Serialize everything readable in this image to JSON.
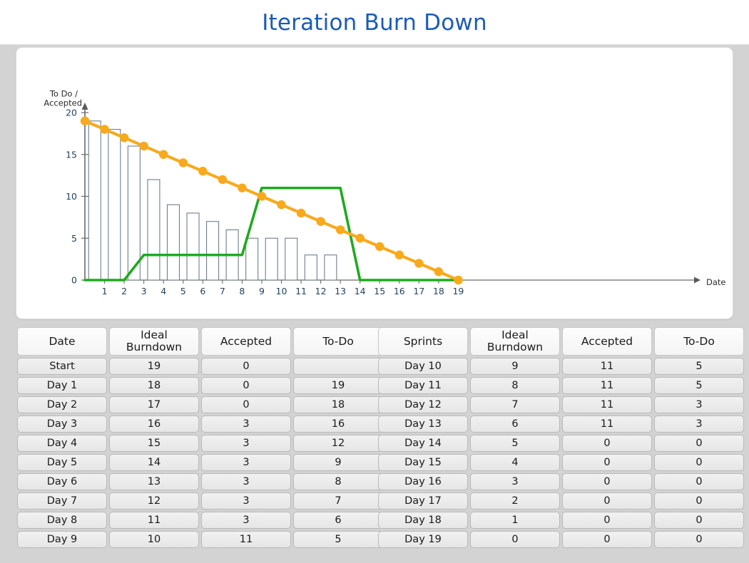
{
  "header": {
    "title": "Iteration Burn Down",
    "title_color": "#1a5cb8"
  },
  "chart_data": {
    "type": "bar",
    "title": "Iteration Burn Down",
    "xlabel": "Date",
    "ylabel": "To Do /\nAccepted",
    "ylabel_line1": "To Do /",
    "ylabel_line2": "Accepted",
    "xlim": [
      0,
      19
    ],
    "ylim": [
      0,
      21
    ],
    "ytick_labels": [
      "0",
      "5",
      "10",
      "15",
      "20"
    ],
    "yticks": [
      0,
      5,
      10,
      15,
      20
    ],
    "xtick_labels": [
      "1",
      "2",
      "3",
      "4",
      "5",
      "6",
      "7",
      "8",
      "9",
      "10",
      "11",
      "12",
      "13",
      "14",
      "15",
      "16",
      "17",
      "18",
      "19"
    ],
    "xticks": [
      1,
      2,
      3,
      4,
      5,
      6,
      7,
      8,
      9,
      10,
      11,
      12,
      13,
      14,
      15,
      16,
      17,
      18,
      19
    ],
    "grid": false,
    "legend": "none",
    "x": [
      0,
      1,
      2,
      3,
      4,
      5,
      6,
      7,
      8,
      9,
      10,
      11,
      12,
      13,
      14,
      15,
      16,
      17,
      18,
      19
    ],
    "series": [
      {
        "name": "Ideal Burndown",
        "type": "line",
        "color": "#f8a91c",
        "marker": "circle",
        "values": [
          19,
          18,
          17,
          16,
          15,
          14,
          13,
          12,
          11,
          10,
          9,
          8,
          7,
          6,
          5,
          4,
          3,
          2,
          1,
          0
        ]
      },
      {
        "name": "Accepted",
        "type": "line",
        "color": "#1faa1f",
        "marker": "none",
        "values": [
          0,
          0,
          0,
          3,
          3,
          3,
          3,
          3,
          3,
          11,
          11,
          11,
          11,
          11,
          0,
          0,
          0,
          0,
          0,
          0
        ]
      },
      {
        "name": "To-Do",
        "type": "bar",
        "color": "#ffffff",
        "edge_color": "#6e7f8d",
        "x": [
          1,
          2,
          3,
          4,
          5,
          6,
          7,
          8,
          9,
          10,
          11,
          12,
          13,
          14,
          15,
          16,
          17,
          18,
          19
        ],
        "values": [
          19,
          18,
          16,
          12,
          9,
          8,
          7,
          6,
          5,
          5,
          5,
          3,
          3,
          0,
          0,
          0,
          0,
          0,
          0
        ]
      }
    ]
  },
  "table_left": {
    "headers": [
      "Date",
      "Ideal\nBurndown",
      "Accepted",
      "To-Do"
    ],
    "header_date": "Date",
    "header_ideal_l1": "Ideal",
    "header_ideal_l2": "Burndown",
    "header_accepted": "Accepted",
    "header_todo": "To-Do",
    "rows": [
      [
        "Start",
        "19",
        "0",
        ""
      ],
      [
        "Day 1",
        "18",
        "0",
        "19"
      ],
      [
        "Day 2",
        "17",
        "0",
        "18"
      ],
      [
        "Day 3",
        "16",
        "3",
        "16"
      ],
      [
        "Day 4",
        "15",
        "3",
        "12"
      ],
      [
        "Day 5",
        "14",
        "3",
        "9"
      ],
      [
        "Day 6",
        "13",
        "3",
        "8"
      ],
      [
        "Day 7",
        "12",
        "3",
        "7"
      ],
      [
        "Day 8",
        "11",
        "3",
        "6"
      ],
      [
        "Day 9",
        "10",
        "11",
        "5"
      ]
    ]
  },
  "table_right": {
    "headers": [
      "Sprints",
      "Ideal\nBurndown",
      "Accepted",
      "To-Do"
    ],
    "header_date": "Sprints",
    "header_ideal_l1": "Ideal",
    "header_ideal_l2": "Burndown",
    "header_accepted": "Accepted",
    "header_todo": "To-Do",
    "rows": [
      [
        "Day 10",
        "9",
        "11",
        "5"
      ],
      [
        "Day 11",
        "8",
        "11",
        "5"
      ],
      [
        "Day 12",
        "7",
        "11",
        "3"
      ],
      [
        "Day 13",
        "6",
        "11",
        "3"
      ],
      [
        "Day 14",
        "5",
        "0",
        "0"
      ],
      [
        "Day 15",
        "4",
        "0",
        "0"
      ],
      [
        "Day 16",
        "3",
        "0",
        "0"
      ],
      [
        "Day 17",
        "2",
        "0",
        "0"
      ],
      [
        "Day 18",
        "1",
        "0",
        "0"
      ],
      [
        "Day 19",
        "0",
        "0",
        "0"
      ]
    ]
  },
  "colors": {
    "ideal": "#f8a91c",
    "accepted": "#1faa1f",
    "bar_edge": "#6e7f8d",
    "axis": "#6b6b6b",
    "page_bg": "#d3d3d3",
    "card_bg": "#ffffff"
  }
}
